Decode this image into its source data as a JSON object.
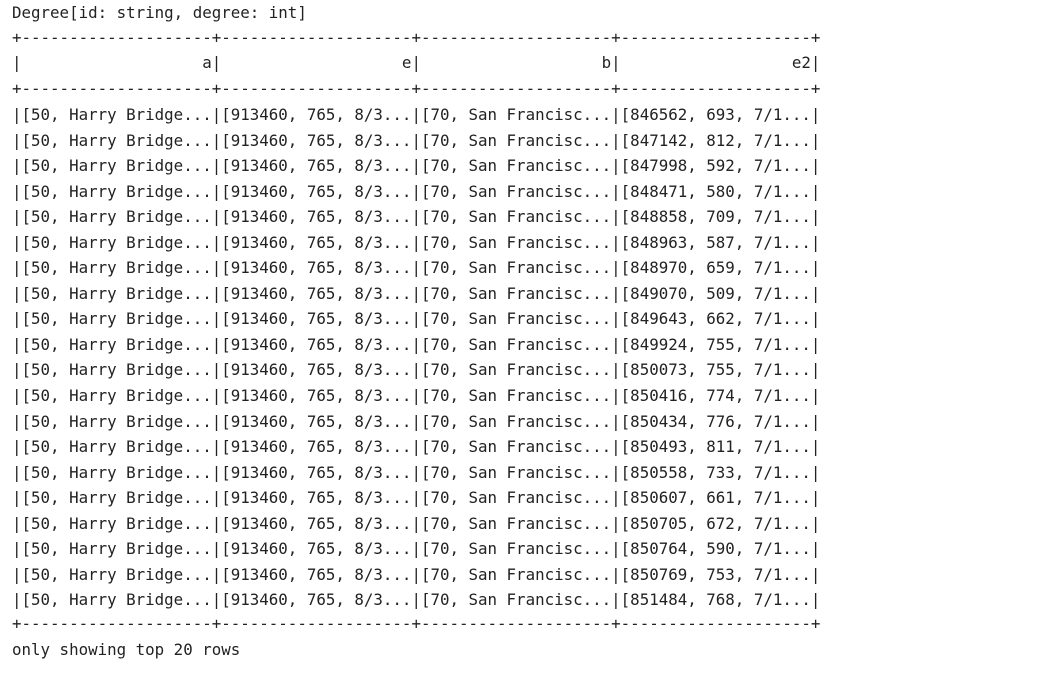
{
  "schema": "Degree[id: string, degree: int]",
  "border": "+--------------------+--------------------+--------------------+--------------------+",
  "header": "|                   a|                   e|                   b|                  e2|",
  "rows": [
    "|[50, Harry Bridge...|[913460, 765, 8/3...|[70, San Francisc...|[846562, 693, 7/1...|",
    "|[50, Harry Bridge...|[913460, 765, 8/3...|[70, San Francisc...|[847142, 812, 7/1...|",
    "|[50, Harry Bridge...|[913460, 765, 8/3...|[70, San Francisc...|[847998, 592, 7/1...|",
    "|[50, Harry Bridge...|[913460, 765, 8/3...|[70, San Francisc...|[848471, 580, 7/1...|",
    "|[50, Harry Bridge...|[913460, 765, 8/3...|[70, San Francisc...|[848858, 709, 7/1...|",
    "|[50, Harry Bridge...|[913460, 765, 8/3...|[70, San Francisc...|[848963, 587, 7/1...|",
    "|[50, Harry Bridge...|[913460, 765, 8/3...|[70, San Francisc...|[848970, 659, 7/1...|",
    "|[50, Harry Bridge...|[913460, 765, 8/3...|[70, San Francisc...|[849070, 509, 7/1...|",
    "|[50, Harry Bridge...|[913460, 765, 8/3...|[70, San Francisc...|[849643, 662, 7/1...|",
    "|[50, Harry Bridge...|[913460, 765, 8/3...|[70, San Francisc...|[849924, 755, 7/1...|",
    "|[50, Harry Bridge...|[913460, 765, 8/3...|[70, San Francisc...|[850073, 755, 7/1...|",
    "|[50, Harry Bridge...|[913460, 765, 8/3...|[70, San Francisc...|[850416, 774, 7/1...|",
    "|[50, Harry Bridge...|[913460, 765, 8/3...|[70, San Francisc...|[850434, 776, 7/1...|",
    "|[50, Harry Bridge...|[913460, 765, 8/3...|[70, San Francisc...|[850493, 811, 7/1...|",
    "|[50, Harry Bridge...|[913460, 765, 8/3...|[70, San Francisc...|[850558, 733, 7/1...|",
    "|[50, Harry Bridge...|[913460, 765, 8/3...|[70, San Francisc...|[850607, 661, 7/1...|",
    "|[50, Harry Bridge...|[913460, 765, 8/3...|[70, San Francisc...|[850705, 672, 7/1...|",
    "|[50, Harry Bridge...|[913460, 765, 8/3...|[70, San Francisc...|[850764, 590, 7/1...|",
    "|[50, Harry Bridge...|[913460, 765, 8/3...|[70, San Francisc...|[850769, 753, 7/1...|",
    "|[50, Harry Bridge...|[913460, 765, 8/3...|[70, San Francisc...|[851484, 768, 7/1...|"
  ],
  "footer": "only showing top 20 rows"
}
